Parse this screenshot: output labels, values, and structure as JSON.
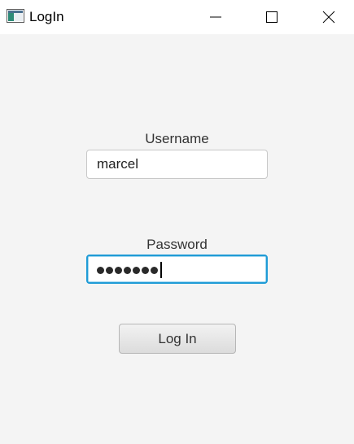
{
  "window": {
    "title": "LogIn",
    "app_icon": "window-app-icon",
    "controls": {
      "minimize_icon": "minimize-icon",
      "maximize_icon": "maximize-icon",
      "close_icon": "close-icon"
    }
  },
  "form": {
    "username_label": "Username",
    "username_value": "marcel",
    "password_label": "Password",
    "password_length": 7,
    "login_button": "Log In"
  },
  "colors": {
    "background": "#f4f4f4",
    "titlebar": "#ffffff",
    "focus_border": "#1f9bd6"
  }
}
